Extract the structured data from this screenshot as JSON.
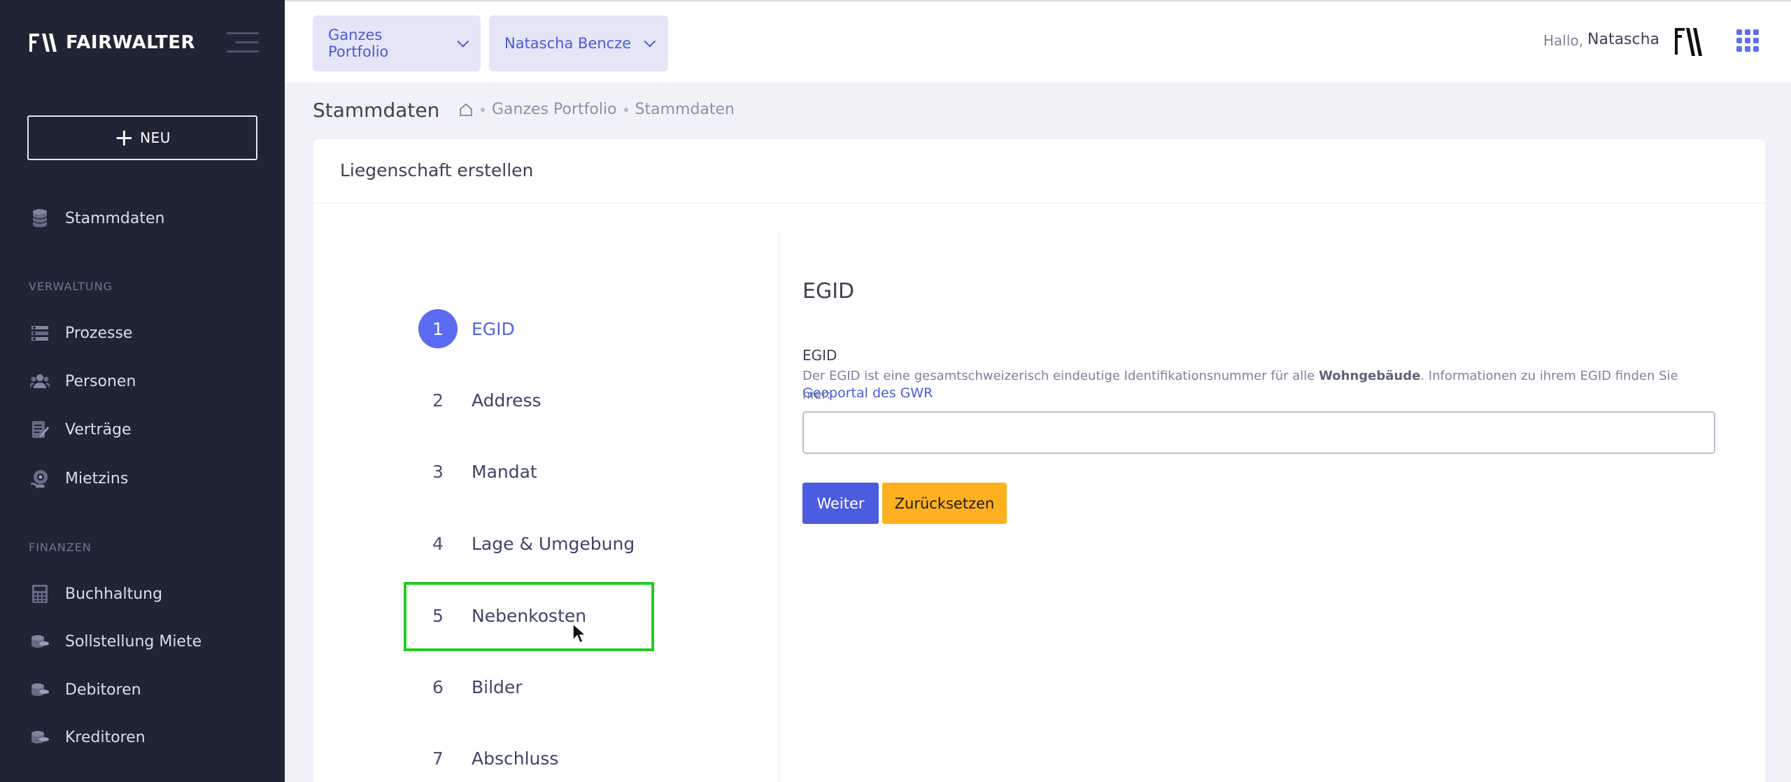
{
  "brand": {
    "name": "FAIRWALTER"
  },
  "sidebar": {
    "new_label": "NEU",
    "top_items": [
      {
        "label": "Stammdaten",
        "icon": "database-icon"
      }
    ],
    "sections": [
      {
        "title": "VERWALTUNG",
        "items": [
          {
            "label": "Prozesse",
            "icon": "list-icon"
          },
          {
            "label": "Personen",
            "icon": "people-icon"
          },
          {
            "label": "Verträge",
            "icon": "contract-icon"
          },
          {
            "label": "Mietzins",
            "icon": "rent-icon"
          }
        ]
      },
      {
        "title": "FINANZEN",
        "items": [
          {
            "label": "Buchhaltung",
            "icon": "calculator-icon"
          },
          {
            "label": "Sollstellung Miete",
            "icon": "coins-icon"
          },
          {
            "label": "Debitoren",
            "icon": "coins-icon"
          },
          {
            "label": "Kreditoren",
            "icon": "coins-icon"
          }
        ]
      }
    ]
  },
  "topbar": {
    "portfolio": "Ganzes Portfolio",
    "user_select": "Natascha Bencze",
    "greeting": "Hallo,",
    "user_name": "Natascha"
  },
  "subheader": {
    "title": "Stammdaten",
    "breadcrumb": [
      "Ganzes Portfolio",
      "Stammdaten"
    ]
  },
  "card": {
    "title": "Liegenschaft erstellen",
    "steps": [
      {
        "num": "1",
        "label": "EGID",
        "active": true
      },
      {
        "num": "2",
        "label": "Address"
      },
      {
        "num": "3",
        "label": "Mandat"
      },
      {
        "num": "4",
        "label": "Lage & Umgebung"
      },
      {
        "num": "5",
        "label": "Nebenkosten",
        "highlighted": true
      },
      {
        "num": "6",
        "label": "Bilder"
      },
      {
        "num": "7",
        "label": "Abschluss"
      }
    ],
    "section_title": "EGID",
    "field": {
      "label": "EGID",
      "help_pre": "Der EGID ist eine gesamtschweizerisch eindeutige Identifikationsnummer für alle ",
      "help_bold": "Wohngebäude",
      "help_post": ". Informationen zu ihrem EGID finden Sie hier:",
      "link": "Geoportal des GWR",
      "value": "",
      "placeholder": ""
    },
    "buttons": {
      "next": "Weiter",
      "reset": "Zurücksetzen"
    }
  },
  "colors": {
    "sidebar_bg": "#1f2535",
    "accent": "#5b6cf0",
    "warning": "#ffb020",
    "highlight": "#22cc22"
  }
}
